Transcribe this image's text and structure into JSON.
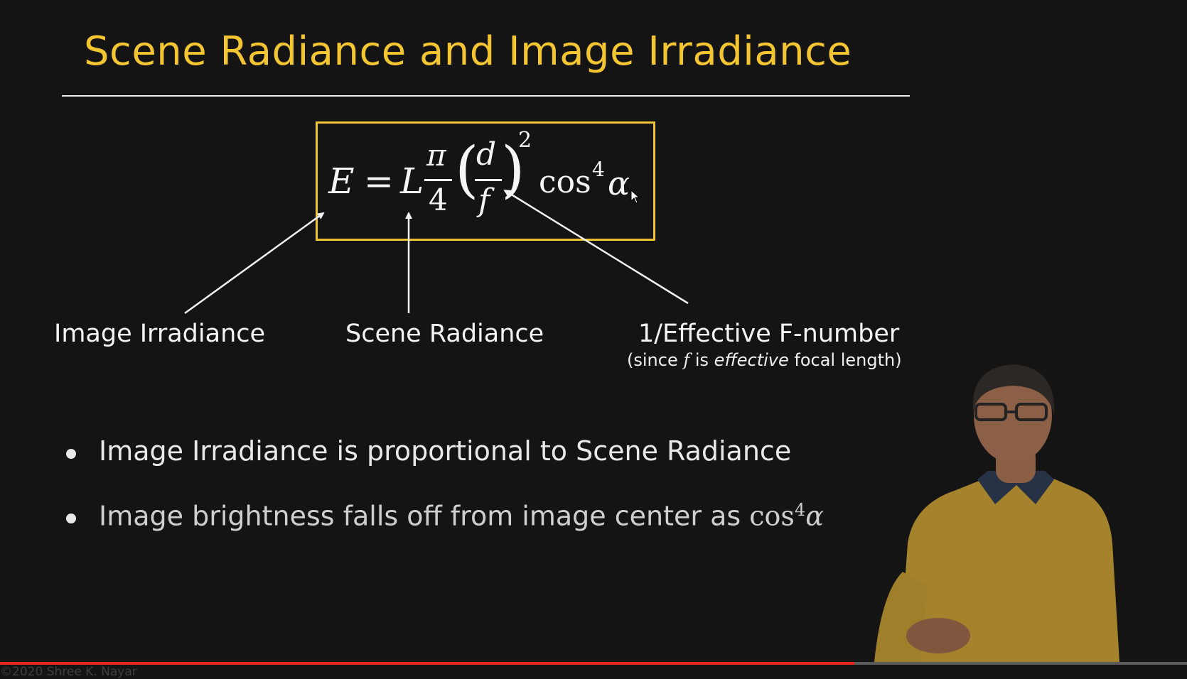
{
  "slide": {
    "title": "Scene Radiance and Image Irradiance",
    "equation": {
      "E": "E",
      "equals": "=",
      "L": "L",
      "pi": "π",
      "four": "4",
      "lparen": "(",
      "d": "d",
      "f": "f",
      "rparen": ")",
      "square": "2",
      "cos": "cos",
      "cos_power": "4",
      "alpha": "α"
    },
    "labels": {
      "image_irradiance": "Image Irradiance",
      "scene_radiance": "Scene Radiance",
      "f_number": "1/Effective F-number",
      "f_note_pre": "(since ",
      "f_note_f": "f",
      "f_note_is": " is ",
      "f_note_effective": "effective",
      "f_note_post": " focal length)"
    },
    "bullets": [
      {
        "text": "Image Irradiance is proportional to Scene Radiance"
      },
      {
        "text": "Image brightness falls off from image center as ",
        "math_cos": "cos",
        "math_pow": "4",
        "math_alpha": "α"
      }
    ]
  },
  "video": {
    "progress_fraction": 0.72,
    "progress_color": "#e52521",
    "credit": "©2020 Shree K. Nayar"
  },
  "colors": {
    "background": "#141414",
    "title": "#f3c531",
    "box_border": "#f0c232",
    "text": "#f4f4f4"
  },
  "icons": {
    "cursor": "mouse-pointer-icon"
  }
}
